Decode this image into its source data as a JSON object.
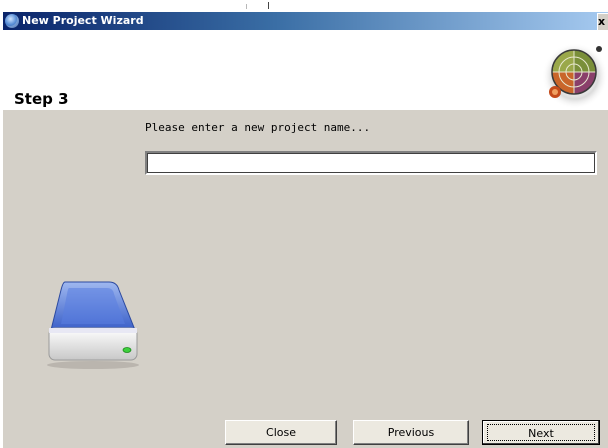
{
  "window": {
    "title": "New Project Wizard",
    "close_glyph": "x"
  },
  "header": {
    "step_title": "Step 3",
    "graphic_icon": "radar-disc-icon"
  },
  "form": {
    "prompt_label": "Please enter a new project name...",
    "project_name_value": "",
    "project_name_placeholder": ""
  },
  "side_graphic": {
    "icon": "hard-drive-icon"
  },
  "buttons": {
    "close_label": "Close",
    "previous_label": "Previous",
    "next_label": "Next"
  },
  "colors": {
    "titlebar_start": "#0a246a",
    "titlebar_end": "#a6caf0",
    "dialog_bg": "#d4d0c8",
    "header_bg": "#ffffff"
  }
}
